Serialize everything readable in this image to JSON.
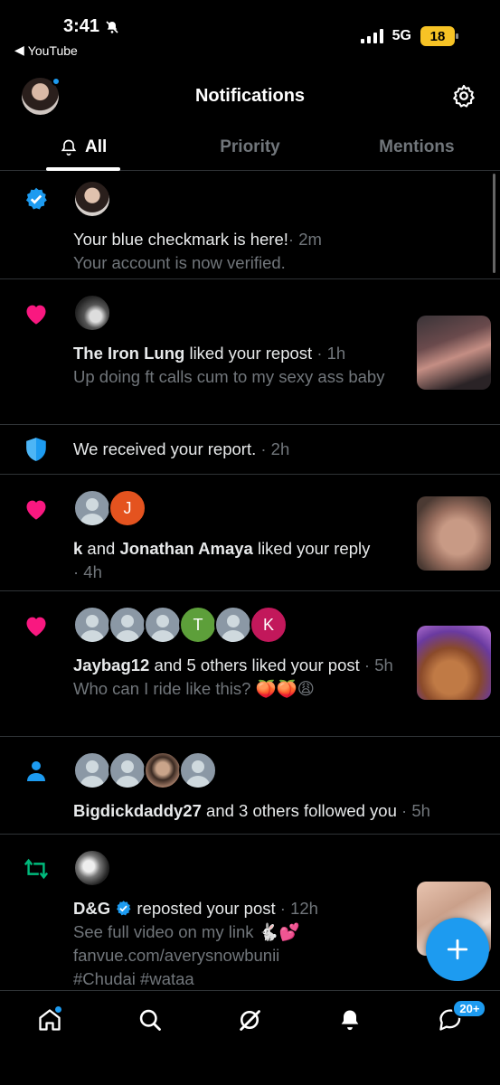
{
  "status_bar": {
    "time": "3:41",
    "back_app": "YouTube",
    "network": "5G",
    "battery": "18"
  },
  "header": {
    "title": "Notifications",
    "tabs": [
      {
        "label": "All",
        "active": true
      },
      {
        "label": "Priority",
        "active": false
      },
      {
        "label": "Mentions",
        "active": false
      }
    ]
  },
  "notifications": [
    {
      "type": "verified",
      "text": "Your blue checkmark is here!",
      "time": "· 2m",
      "sub": "Your account is now verified."
    },
    {
      "type": "like",
      "actor": "The Iron Lung",
      "action": " liked your repost",
      "time": " · 1h",
      "sub": "Up doing ft calls cum to my sexy ass baby"
    },
    {
      "type": "report",
      "text": "We received your report.",
      "time": " · 2h"
    },
    {
      "type": "like",
      "actor1": "k",
      "joiner": " and ",
      "actor2": "Jonathan Amaya",
      "action": " liked your reply",
      "time": "· 4h",
      "avatar_letter": "J"
    },
    {
      "type": "like",
      "actor": "Jaybag12",
      "action": " and 5 others liked your post",
      "time": " · 5h",
      "sub": "Who can I ride like this? 🍑🍑😩",
      "avatar_letters": [
        "T",
        "K"
      ]
    },
    {
      "type": "follow",
      "actor": "Bigdickdaddy27",
      "action": " and 3 others followed you",
      "time": " · 5h"
    },
    {
      "type": "repost",
      "actor": "D&G",
      "action": " reposted your post",
      "time": " · 12h",
      "sub_line1": "See full video on my link 🐇💕",
      "sub_line2": "fanvue.com/averysnowbunii",
      "sub_line3": "#Chudai #wataa"
    }
  ],
  "bottom_nav": {
    "messages_badge": "20+"
  },
  "colors": {
    "accent": "#1d9bf0",
    "like": "#f91880",
    "repost": "#00ba7c",
    "muted": "#71767b",
    "divider": "#2f3336"
  }
}
